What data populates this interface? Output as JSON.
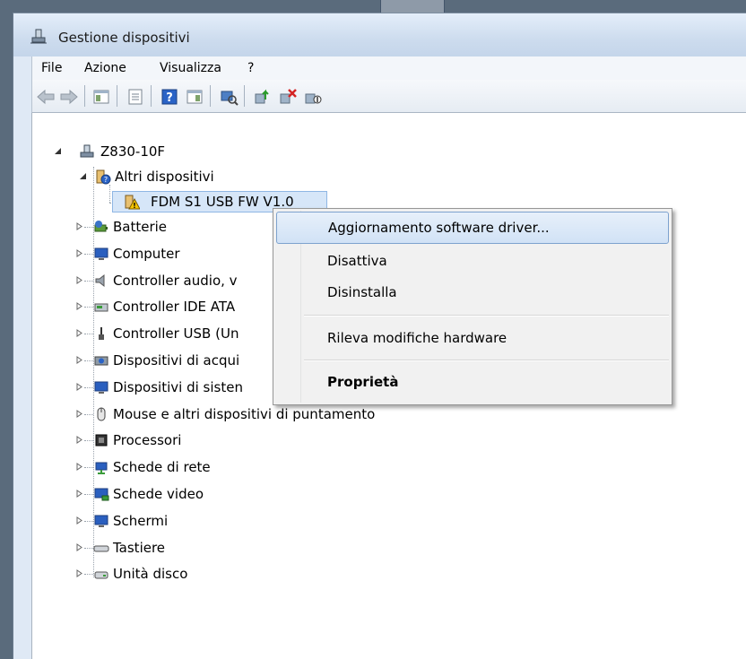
{
  "window": {
    "title": "Gestione dispositivi"
  },
  "menu": [
    "File",
    "Azione",
    "Visualizza",
    "?"
  ],
  "toolbar": [
    "back-arrow-icon",
    "forward-arrow-icon",
    "console-tree-icon",
    "properties-icon",
    "help-icon",
    "action-pane-icon",
    "scan-hardware-icon",
    "update-driver-icon",
    "uninstall-icon",
    "disable-icon"
  ],
  "tree": {
    "root": "Z830-10F",
    "items": [
      {
        "label": "Altri dispositivi",
        "icon": "unknown-device-icon",
        "expanded": true
      },
      {
        "label": "FDM S1 USB FW V1.0",
        "icon": "warning-device-icon",
        "child": true
      },
      {
        "label": "Batterie",
        "icon": "battery-icon"
      },
      {
        "label": "Computer",
        "icon": "computer-icon"
      },
      {
        "label": "Controller audio, v",
        "icon": "speaker-icon"
      },
      {
        "label": "Controller IDE ATA",
        "icon": "ide-controller-icon"
      },
      {
        "label": "Controller USB (Un",
        "icon": "usb-icon"
      },
      {
        "label": "Dispositivi di acqui",
        "icon": "camera-icon"
      },
      {
        "label": "Dispositivi di sisten",
        "icon": "system-device-icon"
      },
      {
        "label": "Mouse e altri dispositivi di puntamento",
        "icon": "mouse-icon"
      },
      {
        "label": "Processori",
        "icon": "processor-icon"
      },
      {
        "label": "Schede di rete",
        "icon": "network-icon"
      },
      {
        "label": "Schede video",
        "icon": "display-adapter-icon"
      },
      {
        "label": "Schermi",
        "icon": "monitor-icon"
      },
      {
        "label": "Tastiere",
        "icon": "keyboard-icon"
      },
      {
        "label": "Unità disco",
        "icon": "disk-drive-icon"
      }
    ]
  },
  "context_menu": {
    "items": [
      {
        "label": "Aggiornamento software driver...",
        "highlighted": true
      },
      {
        "label": "Disattiva"
      },
      {
        "label": "Disinstalla"
      },
      {
        "label": "Rileva modifiche hardware"
      },
      {
        "label": "Proprietà",
        "bold": true
      }
    ]
  }
}
